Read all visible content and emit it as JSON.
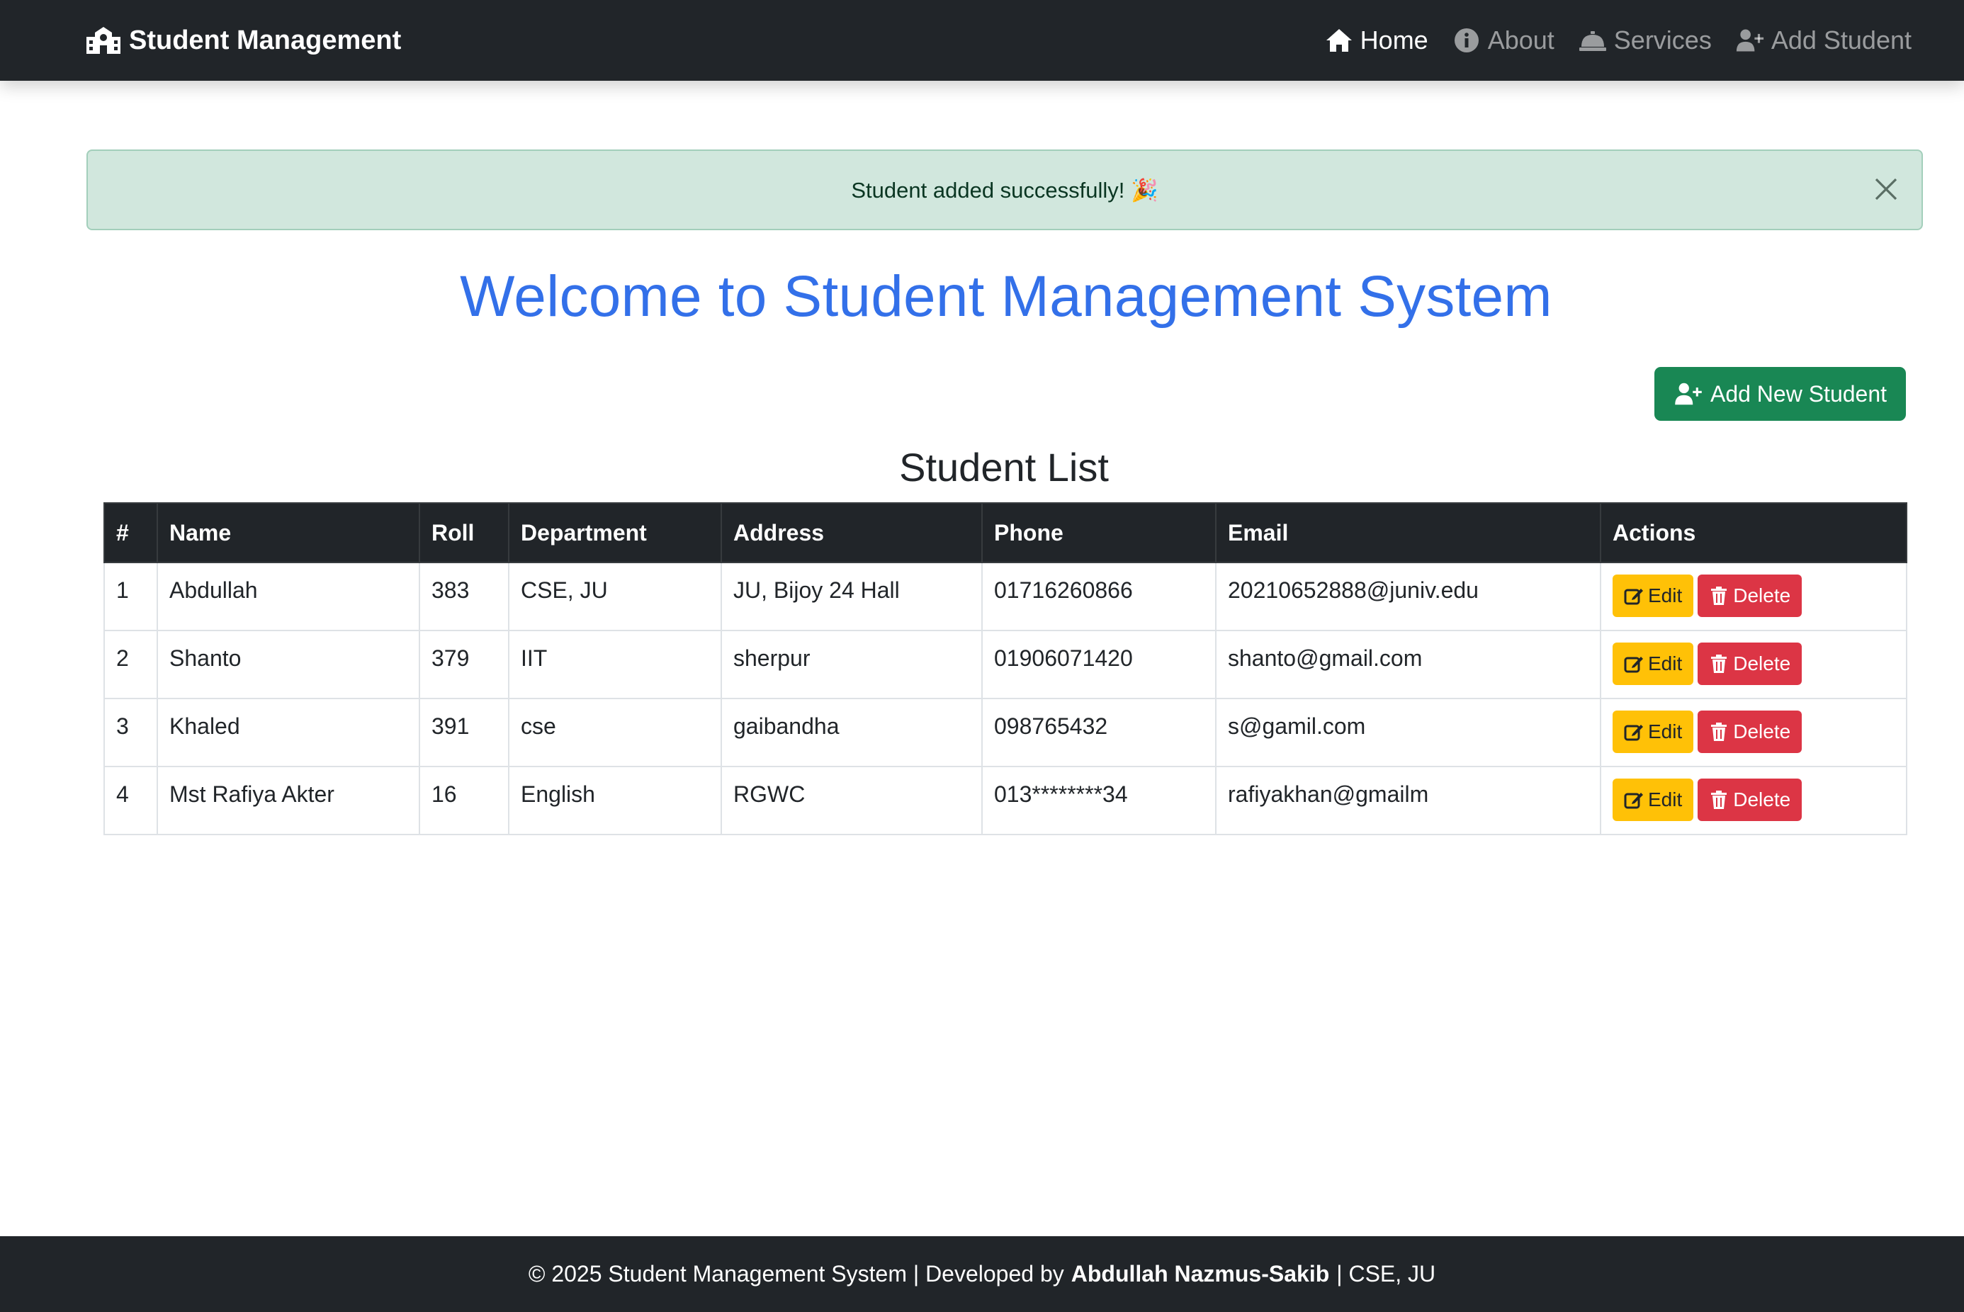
{
  "navbar": {
    "brand": "Student Management",
    "links": [
      {
        "label": "Home",
        "icon": "home-icon",
        "active": true
      },
      {
        "label": "About",
        "icon": "info-circle-icon",
        "active": false
      },
      {
        "label": "Services",
        "icon": "concierge-bell-icon",
        "active": false
      },
      {
        "label": "Add Student",
        "icon": "user-plus-icon",
        "active": false
      }
    ]
  },
  "alert": {
    "message": "Student added successfully! 🎉",
    "type": "success"
  },
  "main": {
    "title": "Welcome to Student Management System",
    "add_button_label": "Add New Student",
    "section_title": "Student List"
  },
  "table": {
    "headers": [
      "#",
      "Name",
      "Roll",
      "Department",
      "Address",
      "Phone",
      "Email",
      "Actions"
    ],
    "rows": [
      {
        "num": "1",
        "name": "Abdullah",
        "roll": "383",
        "department": "CSE, JU",
        "address": "JU, Bijoy 24 Hall",
        "phone": "01716260866",
        "email": "20210652888@juniv.edu"
      },
      {
        "num": "2",
        "name": "Shanto",
        "roll": "379",
        "department": "IIT",
        "address": "sherpur",
        "phone": "01906071420",
        "email": "shanto@gmail.com"
      },
      {
        "num": "3",
        "name": "Khaled",
        "roll": "391",
        "department": "cse",
        "address": "gaibandha",
        "phone": "098765432",
        "email": "s@gamil.com"
      },
      {
        "num": "4",
        "name": "Mst Rafiya Akter",
        "roll": "16",
        "department": "English",
        "address": "RGWC",
        "phone": "013********34",
        "email": "rafiyakhan@gmailm"
      }
    ],
    "edit_label": "Edit",
    "delete_label": "Delete"
  },
  "footer": {
    "prefix": "© 2025 Student Management System | Developed by",
    "author": "Abdullah Nazmus-Sakib",
    "suffix": "| CSE, JU"
  },
  "colors": {
    "navbar_bg": "#212529",
    "primary_title": "#3370e9",
    "success": "#198754",
    "alert_bg": "#d1e7dd",
    "warning": "#ffc107",
    "danger": "#dc3545"
  }
}
